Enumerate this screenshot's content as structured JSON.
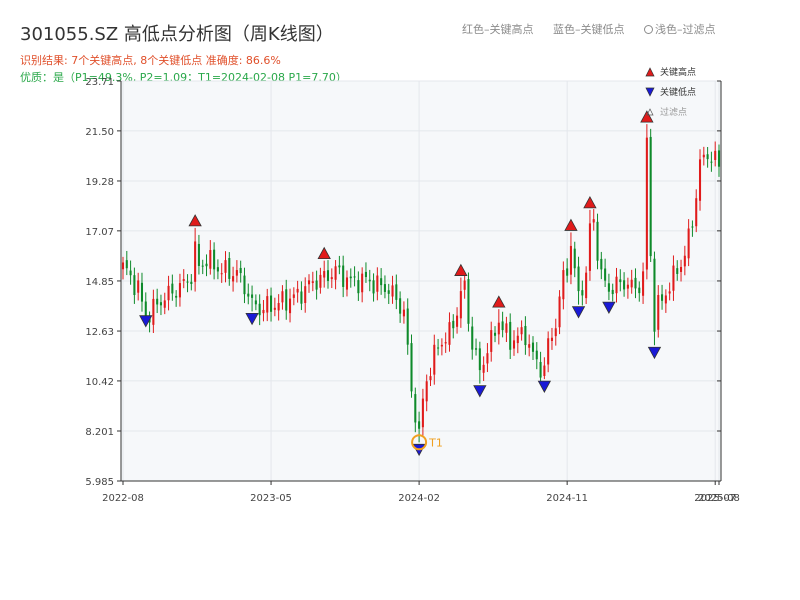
{
  "title": "301055.SZ 高低点分析图（周K线图）",
  "subtitle1": "识别结果: 7个关键高点, 8个关键低点  准确度: 86.6%",
  "subtitle2": "优质：是（P1=49.3%, P2=1.09；T1=2024-02-08 P1=7.70）",
  "color_legend": {
    "high": "红色–关键高点",
    "low": "蓝色–关键低点",
    "filtered": "浅色–过滤点"
  },
  "colors": {
    "up": "#e01b1b",
    "down": "#0e8a2a",
    "high_marker": "#e01b1b",
    "low_marker": "#1a1ad6",
    "t1_ring": "#f0a020",
    "plot_bg": "#f6f8fa"
  },
  "chart_data": {
    "type": "candlestick",
    "ylim": [
      5.985,
      23.71
    ],
    "y_ticks": [
      "5.985",
      "8.201",
      "10.42",
      "12.63",
      "14.85",
      "17.07",
      "19.28",
      "21.50",
      "23.71"
    ],
    "x_ticks": [
      {
        "label": "2022-08",
        "t": 0
      },
      {
        "label": "2023-05",
        "t": 39
      },
      {
        "label": "2024-02",
        "t": 78
      },
      {
        "label": "2024-11",
        "t": 117
      },
      {
        "label": "2025-07",
        "t": 156
      },
      {
        "label": "2025-08",
        "t": 157
      }
    ],
    "n_bars": 158,
    "anchors": [
      [
        0,
        15.5
      ],
      [
        4,
        14.5
      ],
      [
        6,
        13.2
      ],
      [
        10,
        14.0
      ],
      [
        16,
        14.7
      ],
      [
        20,
        15.5
      ],
      [
        22,
        15.8
      ],
      [
        26,
        15.3
      ],
      [
        30,
        15.2
      ],
      [
        34,
        14.0
      ],
      [
        36,
        13.6
      ],
      [
        40,
        13.8
      ],
      [
        46,
        14.2
      ],
      [
        50,
        14.8
      ],
      [
        53,
        15.0
      ],
      [
        56,
        15.3
      ],
      [
        60,
        14.8
      ],
      [
        64,
        14.9
      ],
      [
        68,
        14.6
      ],
      [
        70,
        14.5
      ],
      [
        74,
        13.5
      ],
      [
        76,
        10.0
      ],
      [
        77,
        9.0
      ],
      [
        78,
        8.6
      ],
      [
        80,
        10.5
      ],
      [
        83,
        12.0
      ],
      [
        86,
        12.5
      ],
      [
        88,
        13.5
      ],
      [
        90,
        14.5
      ],
      [
        92,
        12.0
      ],
      [
        94,
        11.0
      ],
      [
        96,
        11.8
      ],
      [
        99,
        13.0
      ],
      [
        102,
        12.2
      ],
      [
        106,
        12.5
      ],
      [
        108,
        11.5
      ],
      [
        110,
        11.0
      ],
      [
        112,
        12.0
      ],
      [
        114,
        13.0
      ],
      [
        116,
        15.0
      ],
      [
        118,
        16.0
      ],
      [
        120,
        14.5
      ],
      [
        122,
        15.0
      ],
      [
        124,
        17.5
      ],
      [
        126,
        15.0
      ],
      [
        128,
        14.5
      ],
      [
        132,
        14.8
      ],
      [
        135,
        14.5
      ],
      [
        137,
        15.0
      ],
      [
        139,
        16.0
      ],
      [
        140,
        13.5
      ],
      [
        142,
        14.0
      ],
      [
        145,
        15.0
      ],
      [
        148,
        16.0
      ],
      [
        150,
        17.5
      ],
      [
        152,
        20.0
      ],
      [
        154,
        20.5
      ],
      [
        157,
        20.0
      ]
    ],
    "key_highs": [
      {
        "t": 19,
        "value": 17.2
      },
      {
        "t": 53,
        "value": 15.75
      },
      {
        "t": 89,
        "value": 15.0
      },
      {
        "t": 99,
        "value": 13.6
      },
      {
        "t": 118,
        "value": 17.0
      },
      {
        "t": 123,
        "value": 18.0
      },
      {
        "t": 138,
        "value": 21.8
      }
    ],
    "key_lows": [
      {
        "t": 6,
        "value": 13.4
      },
      {
        "t": 34,
        "value": 13.5
      },
      {
        "t": 78,
        "value": 7.7
      },
      {
        "t": 94,
        "value": 10.3
      },
      {
        "t": 111,
        "value": 10.5
      },
      {
        "t": 120,
        "value": 13.8
      },
      {
        "t": 128,
        "value": 14.0
      },
      {
        "t": 140,
        "value": 12.0
      }
    ],
    "annotation": {
      "label": "T1",
      "t": 78,
      "value": 7.7
    },
    "legend": {
      "high": "关键高点",
      "low": "关键低点",
      "filtered": "过滤点"
    },
    "grid": true,
    "legend_position": "top-right"
  }
}
